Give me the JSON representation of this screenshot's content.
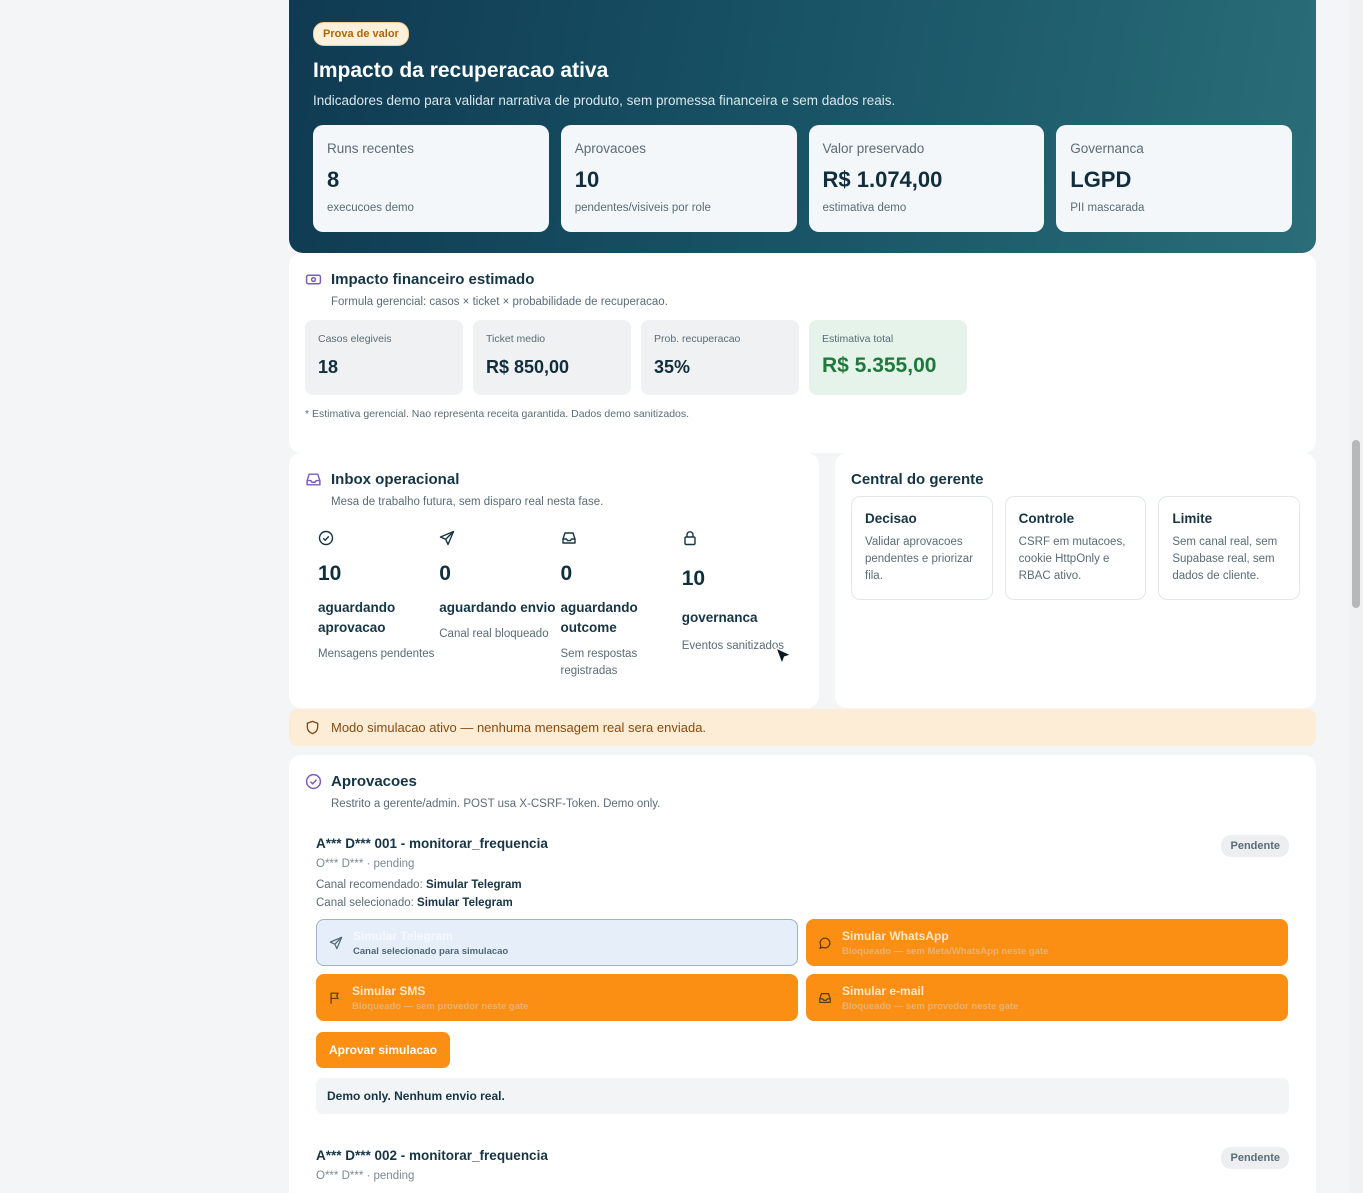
{
  "hero": {
    "pill": "Prova de valor",
    "title": "Impacto da recuperacao ativa",
    "subtitle": "Indicadores demo para validar narrativa de produto, sem promessa financeira e sem dados reais.",
    "kpis": [
      {
        "label": "Runs recentes",
        "value": "8",
        "hint": "execucoes demo"
      },
      {
        "label": "Aprovacoes",
        "value": "10",
        "hint": "pendentes/visiveis por role"
      },
      {
        "label": "Valor preservado",
        "value": "R$ 1.074,00",
        "hint": "estimativa demo"
      },
      {
        "label": "Governanca",
        "value": "LGPD",
        "hint": "PII mascarada"
      }
    ]
  },
  "financial": {
    "icon": "money-icon",
    "title": "Impacto financeiro estimado",
    "subtitle": "Formula gerencial: casos × ticket × probabilidade de recuperacao.",
    "boxes": [
      {
        "label": "Casos elegiveis",
        "value": "18"
      },
      {
        "label": "Ticket medio",
        "value": "R$ 850,00"
      },
      {
        "label": "Prob. recuperacao",
        "value": "35%"
      },
      {
        "label": "Estimativa total",
        "value": "R$ 5.355,00"
      }
    ],
    "footnote": "* Estimativa gerencial. Nao representa receita garantida. Dados demo sanitizados.",
    "total_color": "#1d7a3a"
  },
  "inbox": {
    "icon": "inbox-icon",
    "title": "Inbox operacional",
    "subtitle": "Mesa de trabalho futura, sem disparo real nesta fase.",
    "items": [
      {
        "icon": "check-circle-icon",
        "value": "10",
        "title": "aguardando aprovacao",
        "desc": "Mensagens pendentes"
      },
      {
        "icon": "send-icon",
        "value": "0",
        "title": "aguardando envio",
        "desc": "Canal real bloqueado"
      },
      {
        "icon": "inbox-icon",
        "value": "0",
        "title": "aguardando outcome",
        "desc": "Sem respostas registradas"
      },
      {
        "icon": "lock-icon",
        "value": "10",
        "title": "governanca",
        "desc": "Eventos sanitizados"
      }
    ]
  },
  "central": {
    "title": "Central do gerente",
    "boxes": [
      {
        "title": "Decisao",
        "desc": "Validar aprovacoes pendentes e priorizar fila."
      },
      {
        "title": "Controle",
        "desc": "CSRF em mutacoes, cookie HttpOnly e RBAC ativo."
      },
      {
        "title": "Limite",
        "desc": "Sem canal real, sem Supabase real, sem dados de cliente."
      }
    ]
  },
  "banner": {
    "icon": "shield-icon",
    "text": "Modo simulacao ativo — nenhuma mensagem real sera enviada."
  },
  "approvals": {
    "icon": "check-circle-icon",
    "title": "Aprovacoes",
    "subtitle": "Restrito a gerente/admin. POST usa X-CSRF-Token. Demo only.",
    "items": [
      {
        "title": "A*** D*** 001 - monitorar_frequencia",
        "meta": "O*** D*** · pending",
        "badge": "Pendente",
        "recommended_label": "Canal recomendado:",
        "recommended_value": "Simular Telegram",
        "selected_label": "Canal selecionado:",
        "selected_value": "Simular Telegram",
        "channels": [
          {
            "icon": "send-icon",
            "title": "Simular Telegram",
            "desc": "Canal selecionado para simulacao",
            "selected": true
          },
          {
            "icon": "chat-bubble-icon",
            "title": "Simular WhatsApp",
            "desc": "Bloqueado — sem Meta/WhatsApp neste gate",
            "selected": false
          },
          {
            "icon": "flag-icon",
            "title": "Simular SMS",
            "desc": "Bloqueado — sem provedor neste gate",
            "selected": false
          },
          {
            "icon": "inbox-icon",
            "title": "Simular e-mail",
            "desc": "Bloqueado — sem provedor neste gate",
            "selected": false
          }
        ],
        "approve_label": "Aprovar simulacao",
        "note": "Demo only. Nenhum envio real."
      },
      {
        "title": "A*** D*** 002 - monitorar_frequencia",
        "meta": "O*** D*** · pending",
        "badge": "Pendente"
      }
    ],
    "accent_color": "#fb8f14"
  }
}
